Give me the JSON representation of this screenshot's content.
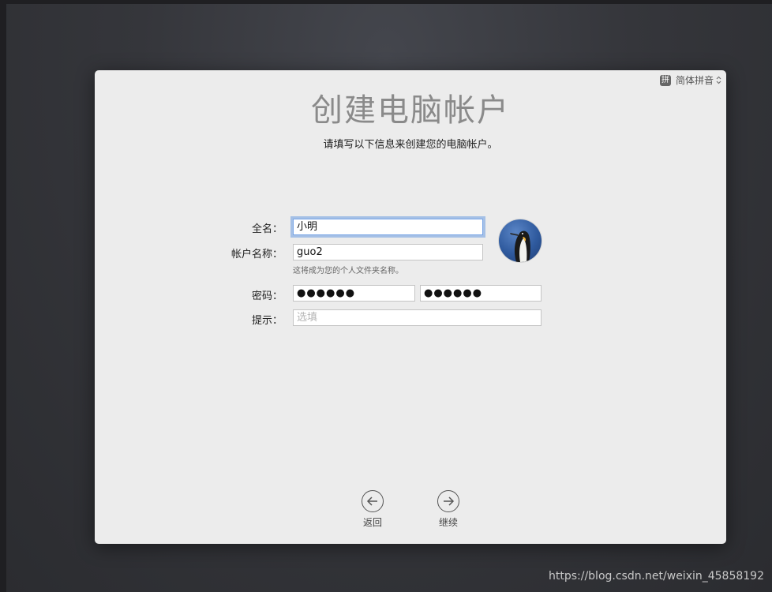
{
  "input_menu": {
    "icon_char": "拼",
    "label": "简体拼音",
    "icon": "chevron-up-down-icon"
  },
  "header": {
    "title": "创建电脑帐户",
    "subtitle": "请填写以下信息来创建您的电脑帐户。"
  },
  "form": {
    "full_name": {
      "label": "全名：",
      "value": "小明"
    },
    "account_name": {
      "label": "帐户名称：",
      "value": "guo2",
      "hint": "这将成为您的个人文件夹名称。"
    },
    "password": {
      "label": "密码：",
      "value": "●●●●●●",
      "verify_value": "●●●●●●"
    },
    "hint_field": {
      "label": "提示：",
      "placeholder": "选填"
    }
  },
  "avatar": {
    "icon": "penguin-avatar-icon"
  },
  "nav": {
    "back": {
      "label": "返回",
      "icon": "arrow-left-icon"
    },
    "continue": {
      "label": "继续",
      "icon": "arrow-right-icon"
    }
  },
  "watermark": "https://blog.csdn.net/weixin_45858192",
  "colors": {
    "focus_ring": "#6c9ce2",
    "window_bg": "#ececec"
  }
}
